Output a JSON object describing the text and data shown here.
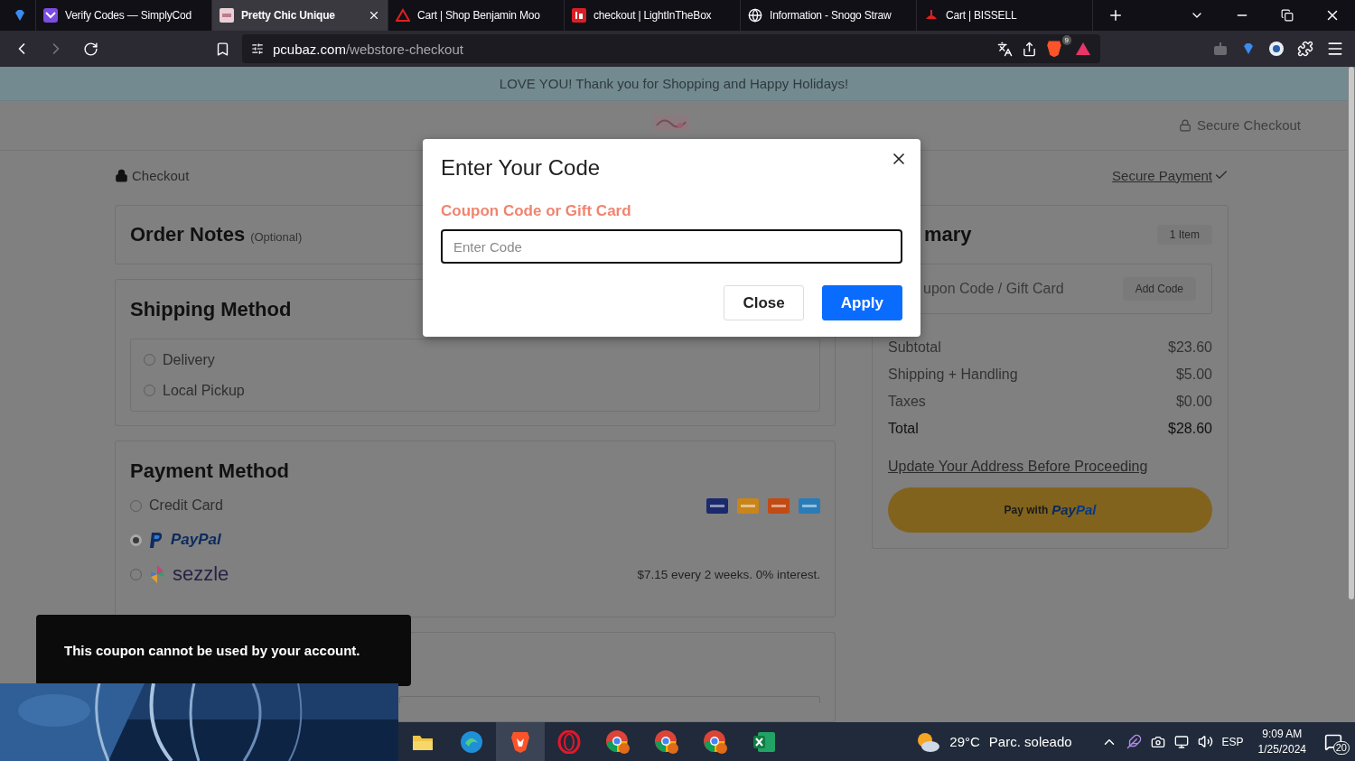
{
  "browser": {
    "tabs": [
      {
        "kind": "gem",
        "selected": false
      },
      {
        "kind": "mail",
        "title": "Verify Codes — SimplyCod",
        "selected": false
      },
      {
        "kind": "page",
        "title": "Pretty Chic Unique",
        "selected": true
      },
      {
        "kind": "triangle",
        "title": "Cart | Shop Benjamin Moo",
        "selected": false
      },
      {
        "kind": "square",
        "title": "checkout | LightInTheBox",
        "selected": false
      },
      {
        "kind": "globe",
        "title": "Information - Snogo Straw",
        "selected": false
      },
      {
        "kind": "swoosh",
        "title": "Cart | BISSELL",
        "selected": false
      }
    ],
    "address": {
      "domain": "pcubaz.com",
      "path": "/webstore-checkout"
    },
    "shield_badge": "9"
  },
  "page": {
    "banner": "LOVE YOU! Thank you for Shopping and Happy Holidays!",
    "secure_checkout": "Secure Checkout",
    "checkout_label": "Checkout",
    "secure_payment": "Secure Payment",
    "order_notes": {
      "title": "Order Notes",
      "hint": "(Optional)"
    },
    "shipping": {
      "title": "Shipping Method",
      "options": [
        {
          "label": "Delivery",
          "selected": false
        },
        {
          "label": "Local Pickup",
          "selected": false
        }
      ]
    },
    "payment": {
      "title": "Payment Method",
      "options": [
        {
          "kind": "cards",
          "label": "Credit Card",
          "selected": false
        },
        {
          "kind": "paypal",
          "label": "PayPal",
          "selected": true
        },
        {
          "kind": "sezzle",
          "label": "sezzle",
          "note": "$7.15 every 2 weeks. 0% interest.",
          "selected": false
        }
      ]
    },
    "summary": {
      "title": "mary",
      "count": "1 Item",
      "coupon_label": "upon Code / Gift Card",
      "add_code": "Add Code",
      "lines": [
        {
          "kind": "line",
          "label": "Subtotal",
          "value": "$23.60"
        },
        {
          "kind": "line",
          "label": "Shipping + Handling",
          "value": "$5.00"
        },
        {
          "kind": "line",
          "label": "Taxes",
          "value": "$0.00"
        },
        {
          "kind": "total",
          "label": "Total",
          "value": "$28.60"
        }
      ],
      "update_link": "Update Your Address Before Proceeding",
      "paypal_button": {
        "prefix": "Pay with",
        "brand_a": "Pay",
        "brand_b": "Pal"
      }
    }
  },
  "modal": {
    "title": "Enter Your Code",
    "label": "Coupon Code or Gift Card",
    "placeholder": "Enter Code",
    "buttons": [
      {
        "kind": "secondary",
        "label": "Close"
      },
      {
        "kind": "primary",
        "label": "Apply"
      }
    ]
  },
  "toast": {
    "text": "This coupon cannot be used by your account."
  },
  "taskbar": {
    "apps": [
      {
        "kind": "folder",
        "selected": false
      },
      {
        "kind": "edge",
        "selected": false
      },
      {
        "kind": "shield",
        "selected": true
      },
      {
        "kind": "ring",
        "selected": false
      },
      {
        "kind": "chrome",
        "selected": false
      },
      {
        "kind": "chrome",
        "selected": false
      },
      {
        "kind": "chrome",
        "selected": false
      },
      {
        "kind": "sheet",
        "selected": false
      }
    ],
    "weather": {
      "temp": "29°C",
      "desc": "Parc. soleado"
    },
    "language": "ESP",
    "time": "9:09 AM",
    "date": "1/25/2024",
    "notifications": "20"
  }
}
